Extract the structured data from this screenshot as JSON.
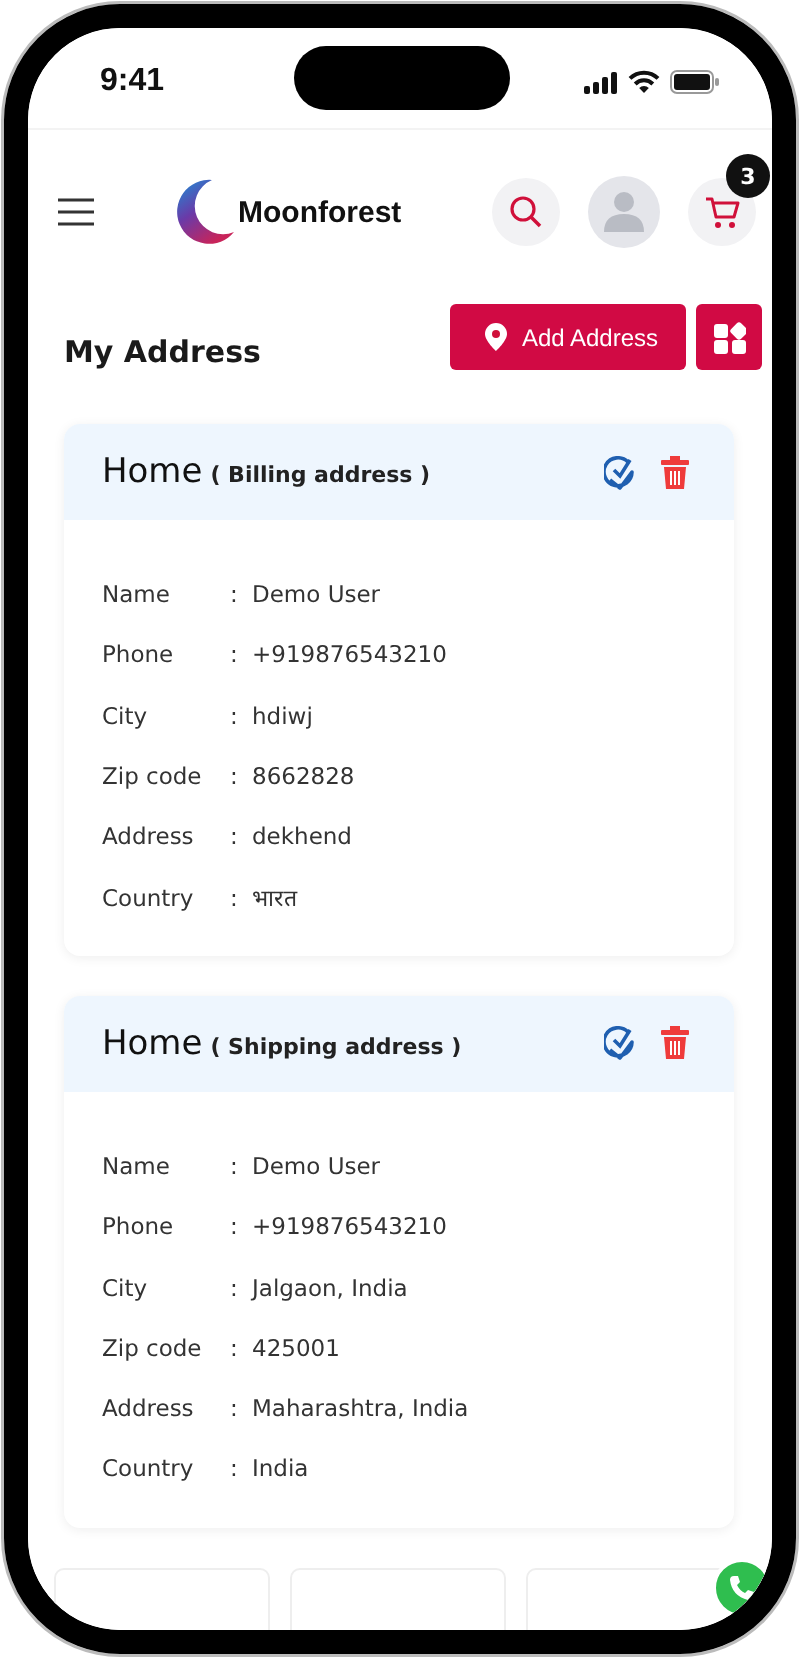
{
  "status_bar": {
    "time": "9:41"
  },
  "header": {
    "brand": "Moonforest",
    "cart_count": "3"
  },
  "page": {
    "title": "My Address",
    "add_button": "Add Address"
  },
  "addresses": [
    {
      "title": "Home",
      "type": "( Billing address )",
      "fields": [
        {
          "label": "Name",
          "separator": ":",
          "value": "Demo User"
        },
        {
          "label": "Phone",
          "separator": ":",
          "value": "+919876543210"
        },
        {
          "label": "City",
          "separator": ":",
          "value": "hdiwj"
        },
        {
          "label": "Zip code",
          "separator": ":",
          "value": "8662828"
        },
        {
          "label": "Address",
          "separator": ":",
          "value": "dekhend"
        },
        {
          "label": "Country",
          "separator": ":",
          "value": "भारत"
        }
      ]
    },
    {
      "title": "Home",
      "type": "( Shipping address )",
      "fields": [
        {
          "label": "Name",
          "separator": ":",
          "value": "Demo User"
        },
        {
          "label": "Phone",
          "separator": ":",
          "value": "+919876543210"
        },
        {
          "label": "City",
          "separator": ":",
          "value": "Jalgaon, India"
        },
        {
          "label": "Zip code",
          "separator": ":",
          "value": "425001"
        },
        {
          "label": "Address",
          "separator": ":",
          "value": "Maharashtra, India"
        },
        {
          "label": "Country",
          "separator": ":",
          "value": "India"
        }
      ]
    }
  ]
}
